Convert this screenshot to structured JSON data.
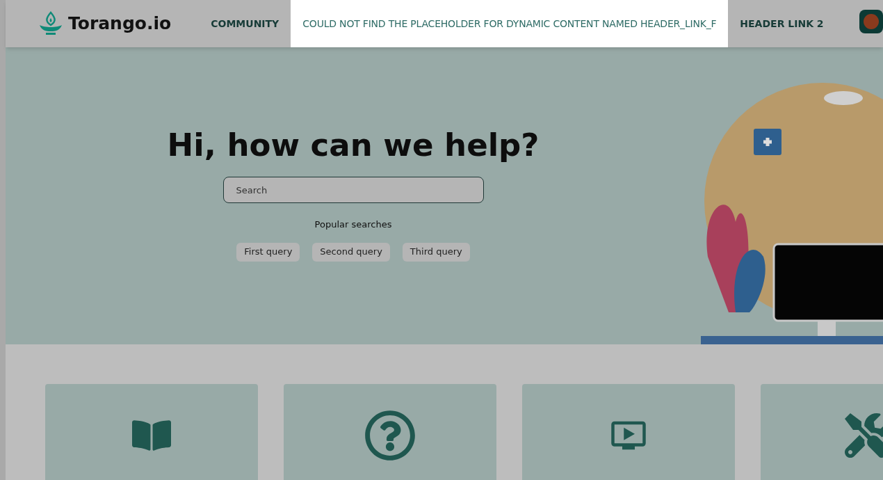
{
  "header": {
    "logo_text": "Torango.io",
    "nav": [
      {
        "label": "COMMUNITY",
        "kind": "link"
      },
      {
        "label": "COULD NOT FIND THE PLACEHOLDER FOR DYNAMIC CONTENT NAMED HEADER_LINK_F",
        "kind": "error"
      },
      {
        "label": "HEADER LINK 2",
        "kind": "link"
      }
    ]
  },
  "hero": {
    "title": "Hi, how can we help?",
    "search": {
      "placeholder": "Search"
    },
    "popular_label": "Popular searches",
    "queries": [
      "First query",
      "Second query",
      "Third query"
    ]
  }
}
